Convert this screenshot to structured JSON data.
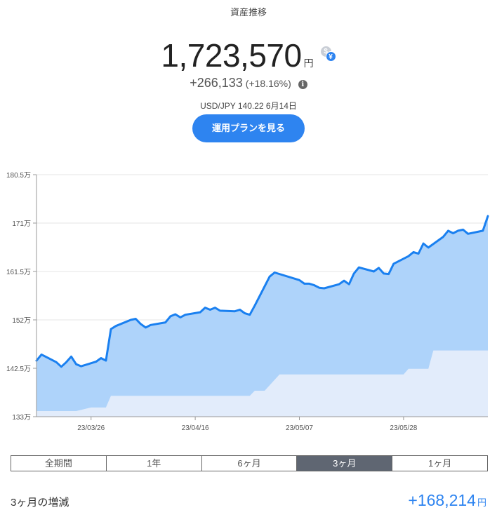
{
  "header": {
    "title": "資産推移",
    "total_amount": "1,723,570",
    "currency_unit": "円",
    "change_amount": "+266,133",
    "change_percent": "(+18.16%)",
    "fx_rate": "USD/JPY 140.22 6月14日",
    "currency_toggle": {
      "icon": "currency-toggle-icon",
      "usd_glyph": "$",
      "jpy_glyph": "¥"
    },
    "info_icon": "i"
  },
  "plan_button": {
    "label": "運用プランを見る"
  },
  "colors": {
    "accent": "#2e84f0",
    "line": "#1a80f0",
    "area_total": "#aed3fa",
    "area_principal": "#e2ecfb",
    "tab_active": "#5f6672"
  },
  "chart_data": {
    "type": "area",
    "y_unit": "円",
    "ylim": [
      1330000,
      1805000
    ],
    "y_ticks": [
      {
        "value": 1330000,
        "label": "133万"
      },
      {
        "value": 1425000,
        "label": "142.5万"
      },
      {
        "value": 1520000,
        "label": "152万"
      },
      {
        "value": 1615000,
        "label": "161.5万"
      },
      {
        "value": 1710000,
        "label": "171万"
      },
      {
        "value": 1805000,
        "label": "180.5万"
      }
    ],
    "x_range": [
      "2023-03-15",
      "2023-06-14"
    ],
    "x_ticks": [
      {
        "date": "2023-03-26",
        "label": "23/03/26"
      },
      {
        "date": "2023-04-16",
        "label": "23/04/16"
      },
      {
        "date": "2023-05-07",
        "label": "23/05/07"
      },
      {
        "date": "2023-05-28",
        "label": "23/05/28"
      }
    ],
    "grid": true,
    "series": [
      {
        "kind": "total",
        "points": [
          [
            "2023-03-15",
            1440000
          ],
          [
            "2023-03-16",
            1452000
          ],
          [
            "2023-03-19",
            1437000
          ],
          [
            "2023-03-20",
            1428000
          ],
          [
            "2023-03-21",
            1437000
          ],
          [
            "2023-03-22",
            1448000
          ],
          [
            "2023-03-23",
            1433000
          ],
          [
            "2023-03-24",
            1429000
          ],
          [
            "2023-03-27",
            1438000
          ],
          [
            "2023-03-28",
            1445000
          ],
          [
            "2023-03-29",
            1440000
          ],
          [
            "2023-03-30",
            1502000
          ],
          [
            "2023-03-31",
            1508000
          ],
          [
            "2023-04-03",
            1520000
          ],
          [
            "2023-04-04",
            1522000
          ],
          [
            "2023-04-05",
            1512000
          ],
          [
            "2023-04-06",
            1505000
          ],
          [
            "2023-04-07",
            1510000
          ],
          [
            "2023-04-10",
            1515000
          ],
          [
            "2023-04-11",
            1527000
          ],
          [
            "2023-04-12",
            1531000
          ],
          [
            "2023-04-13",
            1525000
          ],
          [
            "2023-04-14",
            1530000
          ],
          [
            "2023-04-17",
            1535000
          ],
          [
            "2023-04-18",
            1544000
          ],
          [
            "2023-04-19",
            1540000
          ],
          [
            "2023-04-20",
            1544000
          ],
          [
            "2023-04-21",
            1538000
          ],
          [
            "2023-04-24",
            1537000
          ],
          [
            "2023-04-25",
            1540000
          ],
          [
            "2023-04-26",
            1533000
          ],
          [
            "2023-04-27",
            1530000
          ],
          [
            "2023-04-28",
            1548000
          ],
          [
            "2023-05-01",
            1605000
          ],
          [
            "2023-05-02",
            1613000
          ],
          [
            "2023-05-07",
            1598000
          ],
          [
            "2023-05-08",
            1591000
          ],
          [
            "2023-05-09",
            1591000
          ],
          [
            "2023-05-10",
            1588000
          ],
          [
            "2023-05-11",
            1583000
          ],
          [
            "2023-05-12",
            1582000
          ],
          [
            "2023-05-15",
            1590000
          ],
          [
            "2023-05-16",
            1597000
          ],
          [
            "2023-05-17",
            1590000
          ],
          [
            "2023-05-18",
            1611000
          ],
          [
            "2023-05-19",
            1623000
          ],
          [
            "2023-05-22",
            1615000
          ],
          [
            "2023-05-23",
            1622000
          ],
          [
            "2023-05-24",
            1611000
          ],
          [
            "2023-05-25",
            1610000
          ],
          [
            "2023-05-26",
            1630000
          ],
          [
            "2023-05-29",
            1645000
          ],
          [
            "2023-05-30",
            1653000
          ],
          [
            "2023-05-31",
            1650000
          ],
          [
            "2023-06-01",
            1670000
          ],
          [
            "2023-06-02",
            1662000
          ],
          [
            "2023-06-05",
            1683000
          ],
          [
            "2023-06-06",
            1695000
          ],
          [
            "2023-06-07",
            1690000
          ],
          [
            "2023-06-08",
            1695000
          ],
          [
            "2023-06-09",
            1697000
          ],
          [
            "2023-06-10",
            1689000
          ],
          [
            "2023-06-13",
            1695000
          ],
          [
            "2023-06-14",
            1723570
          ]
        ]
      },
      {
        "kind": "principal",
        "points": [
          [
            "2023-03-15",
            1341000
          ],
          [
            "2023-03-23",
            1341000
          ],
          [
            "2023-03-26",
            1348000
          ],
          [
            "2023-03-29",
            1348000
          ],
          [
            "2023-03-30",
            1371000
          ],
          [
            "2023-04-27",
            1371000
          ],
          [
            "2023-04-28",
            1381000
          ],
          [
            "2023-04-30",
            1381000
          ],
          [
            "2023-05-03",
            1413000
          ],
          [
            "2023-05-28",
            1413000
          ],
          [
            "2023-05-29",
            1424000
          ],
          [
            "2023-06-02",
            1424000
          ],
          [
            "2023-06-03",
            1460000
          ],
          [
            "2023-06-14",
            1460000
          ]
        ]
      }
    ]
  },
  "period_tabs": [
    {
      "label": "全期間",
      "active": false
    },
    {
      "label": "1年",
      "active": false
    },
    {
      "label": "6ヶ月",
      "active": false
    },
    {
      "label": "3ヶ月",
      "active": true
    },
    {
      "label": "1ヶ月",
      "active": false
    }
  ],
  "summary": {
    "label": "3ヶ月の増減",
    "value": "+168,214",
    "unit": "円"
  }
}
